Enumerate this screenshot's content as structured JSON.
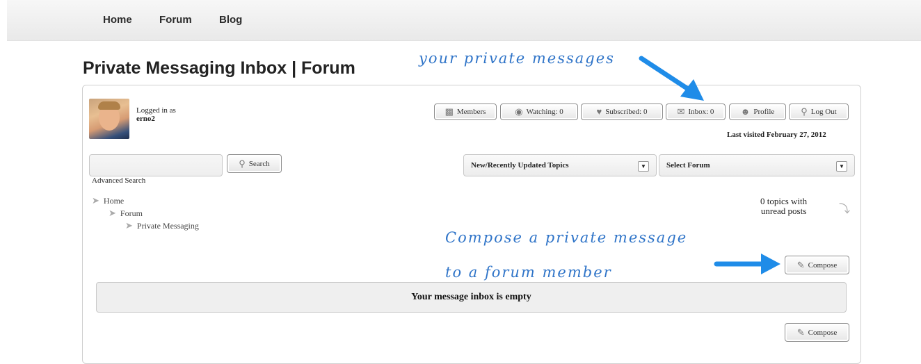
{
  "nav": {
    "home": "Home",
    "forum": "Forum",
    "blog": "Blog"
  },
  "page_title": "Private Messaging Inbox | Forum",
  "annotations": {
    "private_messages": "your private messages",
    "compose_line1": "Compose a private message",
    "compose_line2": "to a forum member",
    "arrow_color": "#1f8ce8"
  },
  "user": {
    "logged_in_label": "Logged in as",
    "username": "erno2"
  },
  "toolbar": {
    "members": "Members",
    "watching": "Watching: 0",
    "subscribed": "Subscribed: 0",
    "inbox": "Inbox: 0",
    "profile": "Profile",
    "logout": "Log Out"
  },
  "last_visited": "Last visited February 27, 2012",
  "search": {
    "button": "Search",
    "advanced": "Advanced Search"
  },
  "filters": {
    "topics_select": "New/Recently Updated Topics",
    "forum_select": "Select Forum"
  },
  "breadcrumb": [
    "Home",
    "Forum",
    "Private Messaging"
  ],
  "unread": {
    "line1": "0 topics with",
    "line2": "unread posts"
  },
  "compose_label": "Compose",
  "empty_message": "Your message inbox is empty"
}
